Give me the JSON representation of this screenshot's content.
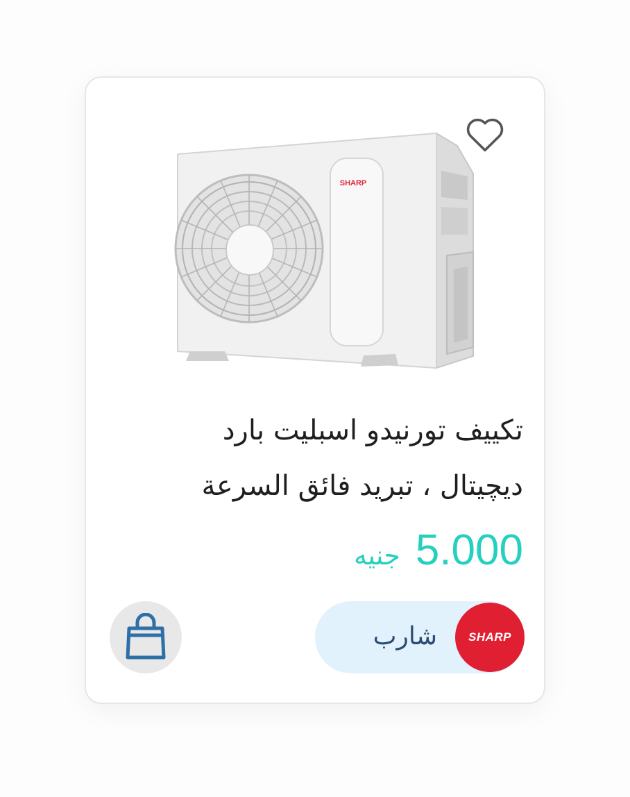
{
  "product": {
    "title_line1": "تكييف تورنيدو اسبليت بارد",
    "title_line2": "ديچيتال ، تبريد فائق السرعة",
    "price": "5.000",
    "currency": "جنيه",
    "image_brand_text": "SHARP"
  },
  "brand": {
    "name": "شارب",
    "logo_text": "SHARP"
  },
  "icons": {
    "favorite": "heart-outline-icon",
    "cart": "shopping-bag-icon"
  },
  "colors": {
    "price": "#26d0bf",
    "brand_pill_bg": "#e2f2fd",
    "brand_logo_bg": "#e01f33",
    "brand_name": "#2b4c74",
    "cart_icon": "#2e6fa8"
  }
}
